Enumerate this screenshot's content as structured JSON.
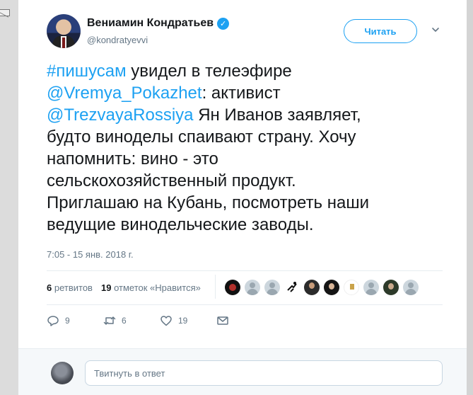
{
  "author": {
    "name": "Вениамин Кондратьев",
    "handle": "@kondratyevvi",
    "verified": true
  },
  "follow_button": {
    "label": "Читать"
  },
  "icons": {
    "verified": "verified-badge-icon",
    "menu": "chevron-down-icon",
    "reply": "reply-icon",
    "retweet": "retweet-icon",
    "like": "heart-icon",
    "dm": "envelope-icon"
  },
  "tweet": {
    "lines": [
      {
        "parts": [
          {
            "text": "#пишусам",
            "link": true
          },
          {
            "text": " увидел в телеэфире",
            "link": false
          }
        ]
      },
      {
        "parts": [
          {
            "text": "@Vremya_Pokazhet",
            "link": true
          },
          {
            "text": ": активист",
            "link": false
          }
        ]
      },
      {
        "parts": [
          {
            "text": "@TrezvayaRossiya",
            "link": true
          },
          {
            "text": " Ян Иванов заявляет,",
            "link": false
          }
        ]
      },
      {
        "parts": [
          {
            "text": "будто виноделы спаивают страну. Хочу",
            "link": false
          }
        ]
      },
      {
        "parts": [
          {
            "text": "напомнить: вино - это",
            "link": false
          }
        ]
      },
      {
        "parts": [
          {
            "text": "сельскохозяйственный продукт.",
            "link": false
          }
        ]
      },
      {
        "parts": [
          {
            "text": "Приглашаю на Кубань, посмотреть наши",
            "link": false
          }
        ]
      },
      {
        "parts": [
          {
            "text": "ведущие винодельческие заводы.",
            "link": false
          }
        ]
      }
    ],
    "timestamp": "7:05 - 15 янв. 2018 г."
  },
  "stats": {
    "retweets_count": "6",
    "retweets_label": "ретвитов",
    "likes_count": "19",
    "likes_label": "отметок «Нравится»"
  },
  "actions": {
    "reply_count": "9",
    "retweet_count": "6",
    "like_count": "19"
  },
  "reply": {
    "placeholder": "Твитнуть в ответ"
  },
  "colors": {
    "link": "#1da1f2",
    "secondary_text": "#657786",
    "text": "#14171a"
  }
}
